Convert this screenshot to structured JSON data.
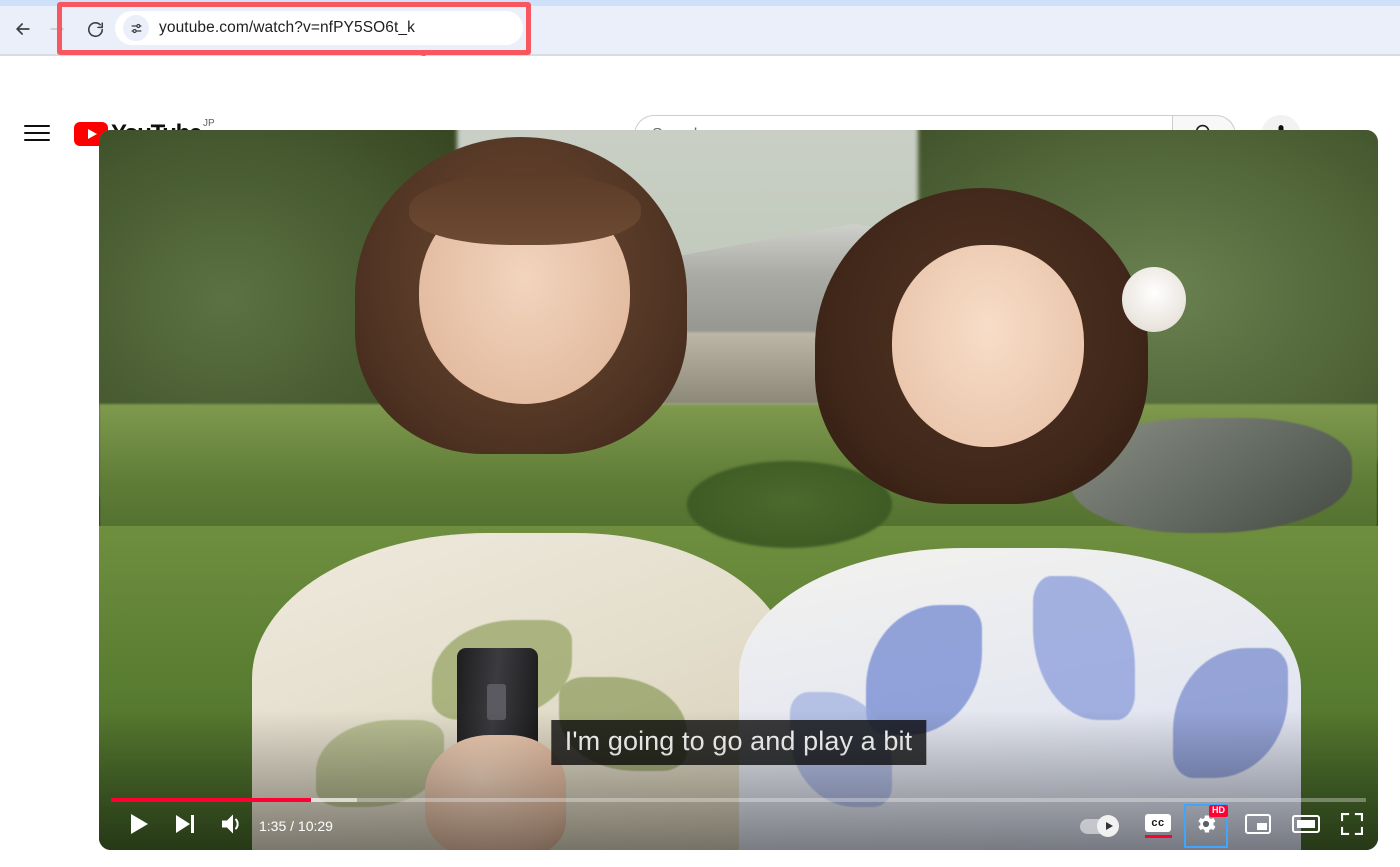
{
  "browser": {
    "back_icon": "back-arrow-icon",
    "forward_icon": "forward-arrow-icon",
    "reload_icon": "reload-icon",
    "site_settings_icon": "site-settings-icon",
    "url": "youtube.com/watch?v=nfPY5SO6t_k",
    "url_highlight_color": "#f8575f",
    "toolbar_bg": "#eaeff9",
    "tabstrip_bg": "#cfe0fb"
  },
  "annotation": {
    "arrow_name": "red-arrow-annotation",
    "arrow_color": "#f8575f",
    "points_to": "url-bar"
  },
  "header": {
    "menu_icon": "hamburger-menu-icon",
    "logo": {
      "wordmark": "YouTube",
      "country_code": "JP",
      "badge_color": "#ff0000"
    },
    "search": {
      "placeholder": "Search",
      "value": "",
      "search_icon": "search-icon",
      "mic_icon": "microphone-icon"
    }
  },
  "player": {
    "caption_text": "I'm going to go and play a bit",
    "current_time": "1:35",
    "duration": "10:29",
    "time_display": "1:35 / 10:29",
    "progress_percent": 15,
    "buffered_percent": 19,
    "progress_color": "#ff0033",
    "controls": {
      "play_icon": "play-icon",
      "next_icon": "next-video-icon",
      "volume_icon": "volume-icon",
      "autoplay_label": "Autoplay",
      "autoplay_on": true,
      "captions_label": "cc",
      "captions_active": true,
      "settings_icon": "settings-gear-icon",
      "settings_quality_badge": "HD",
      "settings_focused": true,
      "focus_ring_color": "#3ea6ff",
      "miniplayer_icon": "miniplayer-icon",
      "theater_icon": "theater-mode-icon",
      "fullscreen_icon": "fullscreen-icon"
    }
  }
}
